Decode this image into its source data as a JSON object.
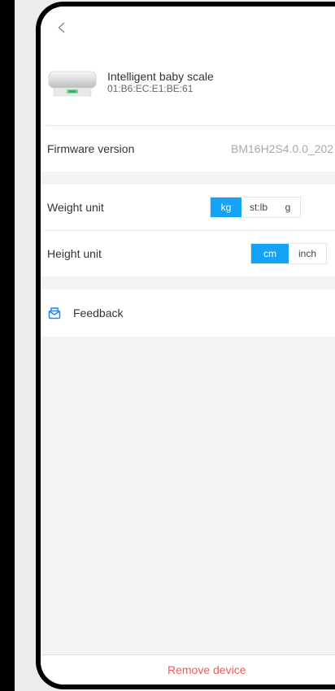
{
  "device": {
    "name": "Intelligent baby scale",
    "mac": "01:B6:EC:E1:BE:61",
    "image": "baby-scale-thumbnail"
  },
  "firmware": {
    "label": "Firmware version",
    "value": "BM16H2S4.0.0_202"
  },
  "weight_unit": {
    "label": "Weight unit",
    "options": [
      "kg",
      "st:lb",
      "g"
    ],
    "selected": "kg"
  },
  "height_unit": {
    "label": "Height unit",
    "options": [
      "cm",
      "inch"
    ],
    "selected": "cm"
  },
  "feedback": {
    "label": "Feedback",
    "icon": "feedback-icon"
  },
  "remove": {
    "label": "Remove device"
  },
  "colors": {
    "accent": "#14a3f7",
    "danger": "#ef5a5a",
    "feedback_icon": "#1f88f0"
  },
  "icons": {
    "back": "chevron-left-icon"
  }
}
